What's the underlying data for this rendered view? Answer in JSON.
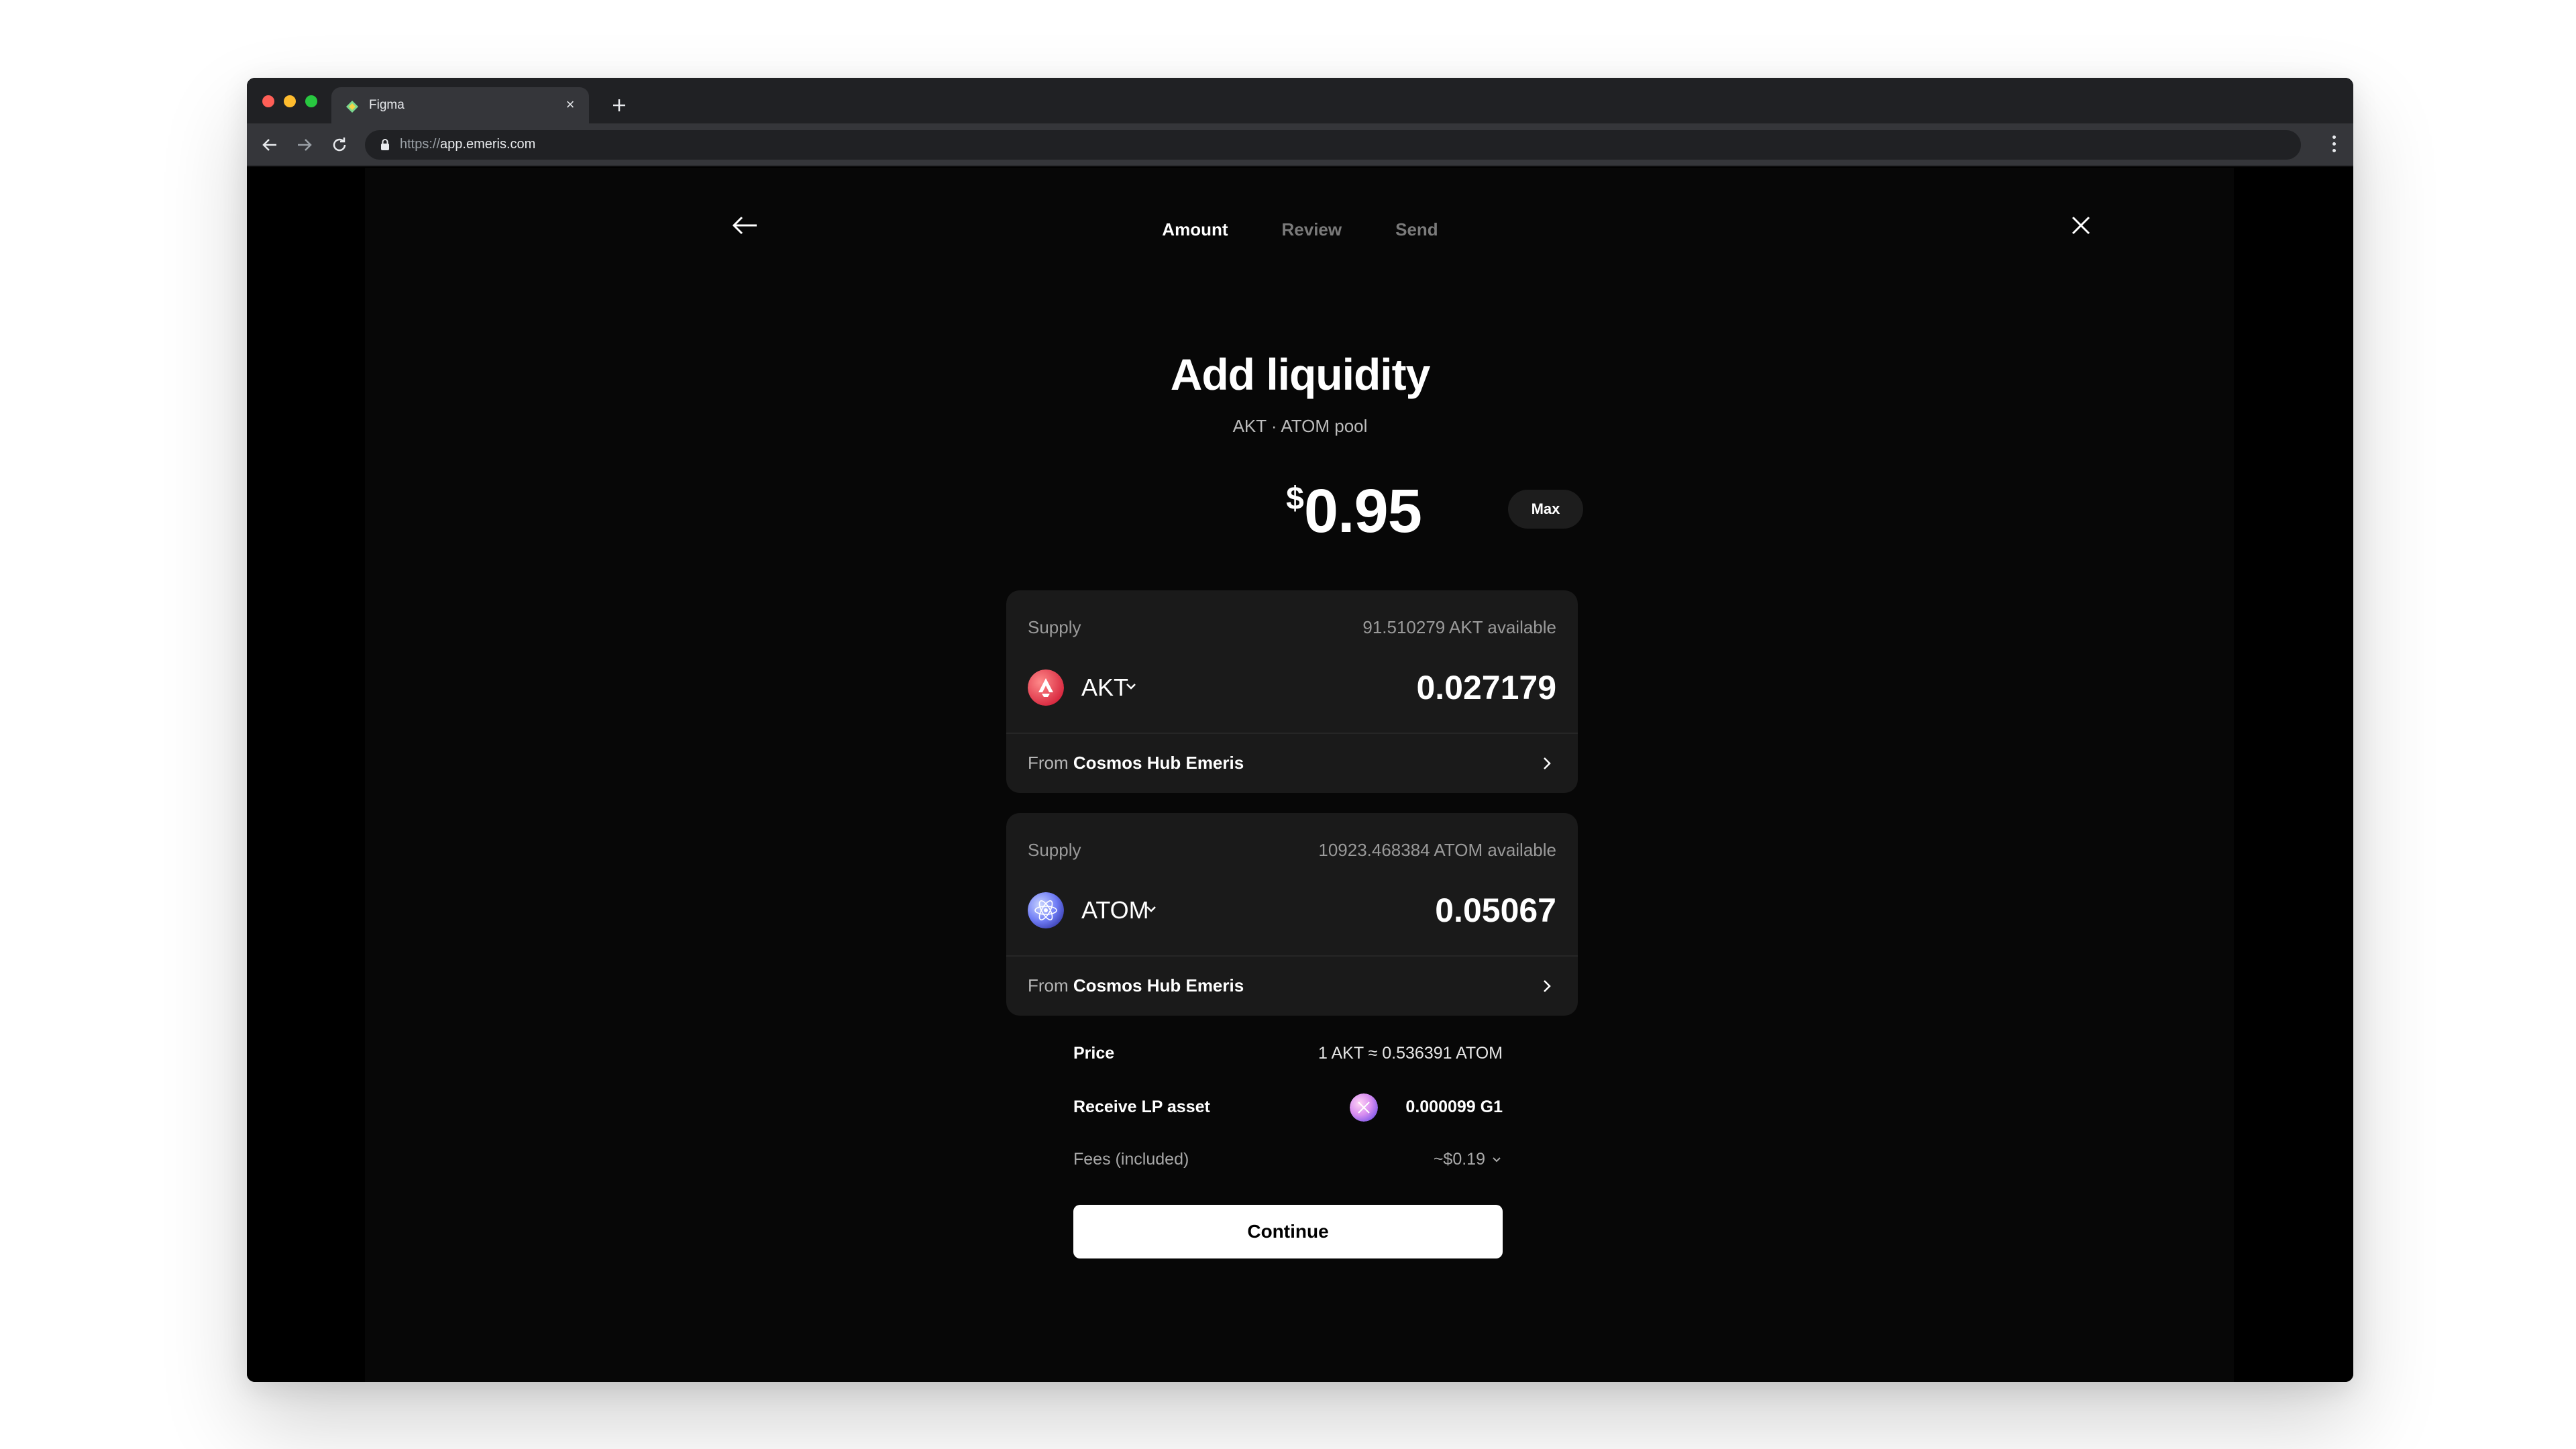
{
  "browser": {
    "tab_title": "Figma",
    "tab_close": "×",
    "url_scheme": "https://",
    "url_host": "app.emeris.com",
    "icons": [
      "figma-favicon",
      "close-icon",
      "plus-icon",
      "back-icon",
      "forward-icon",
      "reload-icon",
      "lock-icon",
      "more-vert-icon"
    ]
  },
  "steps": [
    {
      "label": "Amount",
      "active": true
    },
    {
      "label": "Review",
      "active": false
    },
    {
      "label": "Send",
      "active": false
    }
  ],
  "header": {
    "title": "Add liquidity",
    "subtitle": "AKT · ATOM pool"
  },
  "amount": {
    "currency": "$",
    "value": "0.95",
    "max_label": "Max"
  },
  "supply_akt": {
    "label": "Supply",
    "available": "91.510279 AKT available",
    "token": "AKT",
    "amount": "0.027179",
    "from_prefix": "From",
    "from_chain": "Cosmos Hub Emeris"
  },
  "supply_atom": {
    "label": "Supply",
    "available": "10923.468384 ATOM available",
    "token": "ATOM",
    "amount": "0.05067",
    "from_prefix": "From",
    "from_chain": "Cosmos Hub Emeris"
  },
  "details": {
    "price_label": "Price",
    "price_value": "1 AKT ≈ 0.536391 ATOM",
    "receive_label": "Receive LP asset",
    "receive_value": "0.000099 G1",
    "fees_label": "Fees (included)",
    "fees_value": "~$0.19"
  },
  "continue_label": "Continue",
  "colors": {
    "akt_logo": "#e6455a",
    "atom_logo": "#6f7cf5",
    "lp_logo": "#d88ef0",
    "active_step": "#ffffff",
    "inactive_step": "#7a7a7a",
    "card_bg": "#1a1a1a"
  }
}
